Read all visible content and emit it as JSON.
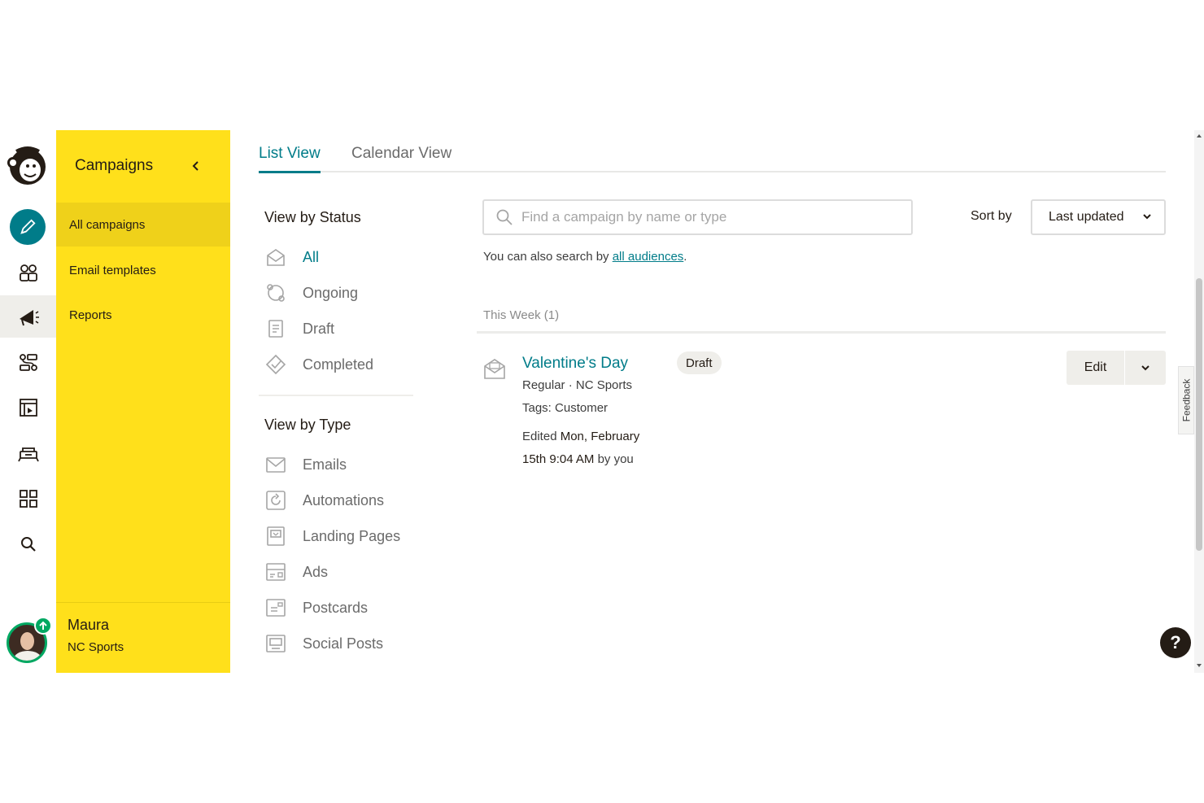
{
  "sidebar": {
    "title": "Campaigns",
    "items": [
      {
        "label": "All campaigns",
        "active": true
      },
      {
        "label": "Email templates",
        "active": false
      },
      {
        "label": "Reports",
        "active": false
      }
    ],
    "user": {
      "name": "Maura",
      "org": "NC Sports"
    }
  },
  "tabs": [
    {
      "label": "List View",
      "active": true
    },
    {
      "label": "Calendar View",
      "active": false
    }
  ],
  "filters": {
    "status_heading": "View by Status",
    "status": [
      {
        "label": "All",
        "icon": "all-campaigns-icon",
        "active": true
      },
      {
        "label": "Ongoing",
        "icon": "ongoing-icon"
      },
      {
        "label": "Draft",
        "icon": "draft-icon"
      },
      {
        "label": "Completed",
        "icon": "completed-icon"
      }
    ],
    "type_heading": "View by Type",
    "types": [
      {
        "label": "Emails",
        "icon": "email-icon"
      },
      {
        "label": "Automations",
        "icon": "automation-icon"
      },
      {
        "label": "Landing Pages",
        "icon": "landing-page-icon"
      },
      {
        "label": "Ads",
        "icon": "ads-icon"
      },
      {
        "label": "Postcards",
        "icon": "postcard-icon"
      },
      {
        "label": "Social Posts",
        "icon": "social-post-icon"
      }
    ]
  },
  "search": {
    "placeholder": "Find a campaign by name or type"
  },
  "hint": {
    "prefix": "You can also search by ",
    "link": "all audiences",
    "suffix": "."
  },
  "sort": {
    "label": "Sort by",
    "value": "Last updated"
  },
  "group": {
    "label": "This Week (1)"
  },
  "campaign": {
    "title": "Valentine's Day",
    "type": "Regular · NC Sports",
    "tags": "Tags: Customer",
    "edited_prefix": "Edited ",
    "edited_date1": "Mon, February",
    "edited_date2": "15th 9:04 AM",
    "edited_suffix": " by you",
    "status": "Draft",
    "edit_label": "Edit"
  },
  "feedback": "Feedback",
  "help": "?",
  "colors": {
    "brand_yellow": "#ffe01b",
    "accent_teal": "#007c89",
    "status_green": "#00a862"
  }
}
